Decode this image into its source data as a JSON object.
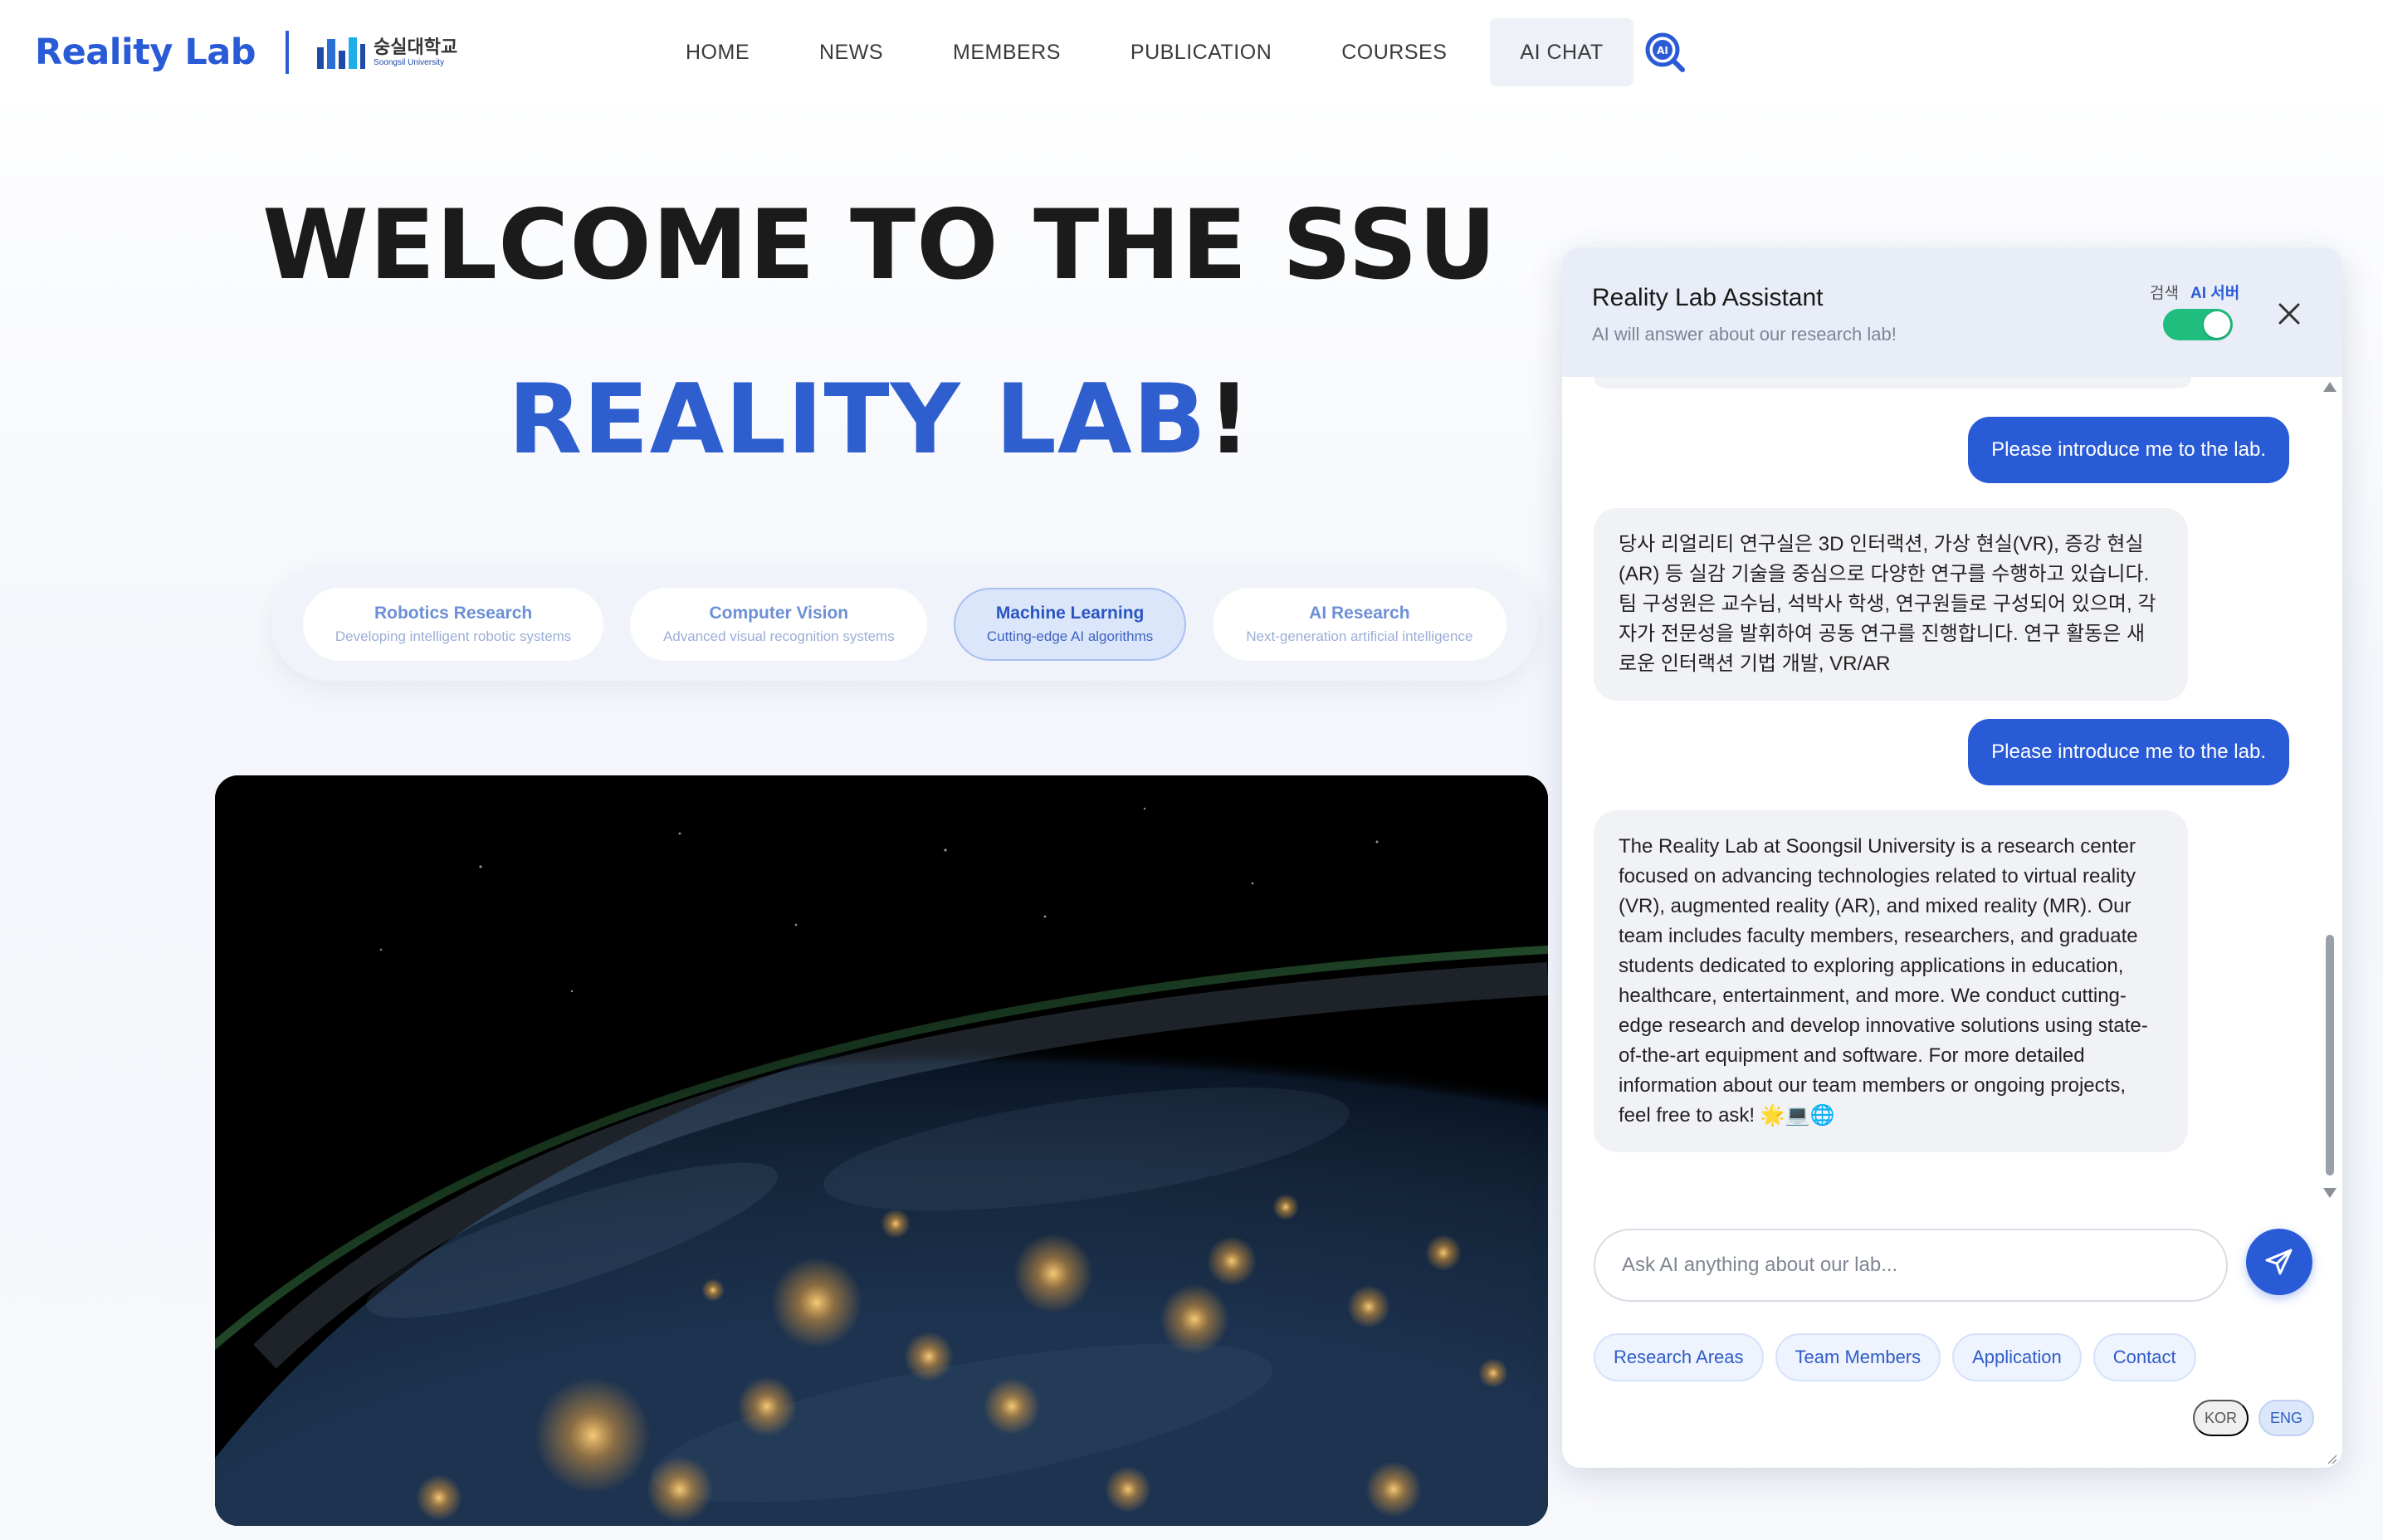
{
  "navbar": {
    "brand": "Reality Lab",
    "university_ko": "숭실대학교",
    "university_en": "Soongsil University",
    "menu": [
      {
        "label": "HOME"
      },
      {
        "label": "NEWS"
      },
      {
        "label": "MEMBERS"
      },
      {
        "label": "PUBLICATION"
      },
      {
        "label": "COURSES"
      },
      {
        "label": "AI CHAT",
        "active": true
      }
    ],
    "search_icon": "ai-search-icon",
    "search_icon_text": "AI"
  },
  "hero": {
    "line1": "WELCOME TO THE SSU",
    "line2_accent": "REALITY LAB",
    "line2_mark": "!",
    "accent_color": "#2f5fcf"
  },
  "categories": [
    {
      "title": "Robotics Research",
      "desc": "Developing intelligent robotic systems"
    },
    {
      "title": "Computer Vision",
      "desc": "Advanced visual recognition systems"
    },
    {
      "title": "Machine Learning",
      "desc": "Cutting-edge AI algorithms",
      "active": true
    },
    {
      "title": "AI Research",
      "desc": "Next-generation artificial intelligence"
    }
  ],
  "chat": {
    "title": "Reality Lab Assistant",
    "subtitle": "AI will answer about our research lab!",
    "mode_left": "검색",
    "mode_right": "AI 서버",
    "toggle_on": true,
    "messages": [
      {
        "role": "user",
        "text": "Please introduce me to the lab."
      },
      {
        "role": "bot",
        "text": "당사 리얼리티 연구실은 3D 인터랙션, 가상 현실(VR), 증강 현실(AR) 등 실감 기술을 중심으로 다양한 연구를 수행하고 있습니다. 팀 구성원은 교수님, 석박사 학생, 연구원들로 구성되어 있으며, 각자가 전문성을 발휘하여 공동 연구를 진행합니다. 연구 활동은 새로운 인터랙션 기법 개발, VR/AR"
      },
      {
        "role": "user",
        "text": "Please introduce me to the lab."
      },
      {
        "role": "bot",
        "text": "The Reality Lab at Soongsil University is a research center focused on advancing technologies related to virtual reality (VR), augmented reality (AR), and mixed reality (MR). Our team includes faculty members, researchers, and graduate students dedicated to exploring applications in education, healthcare, entertainment, and more. We conduct cutting-edge research and develop innovative solutions using state-of-the-art equipment and software. For more detailed information about our team members or ongoing projects, feel free to ask! 🌟💻🌐"
      }
    ],
    "input_placeholder": "Ask AI anything about our lab...",
    "quick_actions": [
      "Research Areas",
      "Team Members",
      "Application",
      "Contact"
    ],
    "languages": [
      {
        "label": "KOR"
      },
      {
        "label": "ENG",
        "active": true
      }
    ],
    "user_bubble_color": "#2a5bd7",
    "toggle_color": "#1fbe7f"
  }
}
